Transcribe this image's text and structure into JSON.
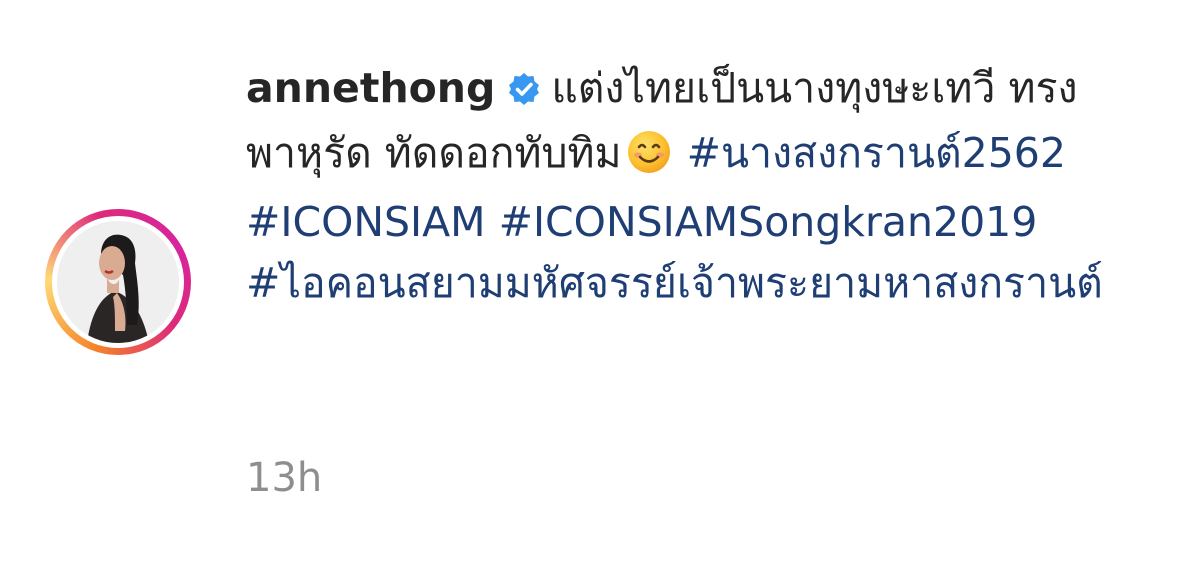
{
  "post": {
    "username": "annethong",
    "caption_text_1": "แต่งไทยเป็นนางทุงษะเทวี",
    "caption_text_2": "ทรงพาหุรัด ทัดดอกทับทิม",
    "hashtag_1": "#นางสงกรานต์2562",
    "hashtag_2": "#ICONSIAM",
    "hashtag_3": "#ICONSIAMSongkran2019",
    "hashtag_4": "#ไอคอนสยามมหัศจรรย์เจ้าพระยามหาสงกรานต์",
    "timestamp": "13h"
  },
  "icons": {
    "verified": "verified-badge-icon",
    "emoji": "smiling-face-emoji"
  },
  "colors": {
    "text": "#262626",
    "hashtag": "#1e3e74",
    "timestamp": "#8e8e8e",
    "verified": "#3897f0"
  }
}
